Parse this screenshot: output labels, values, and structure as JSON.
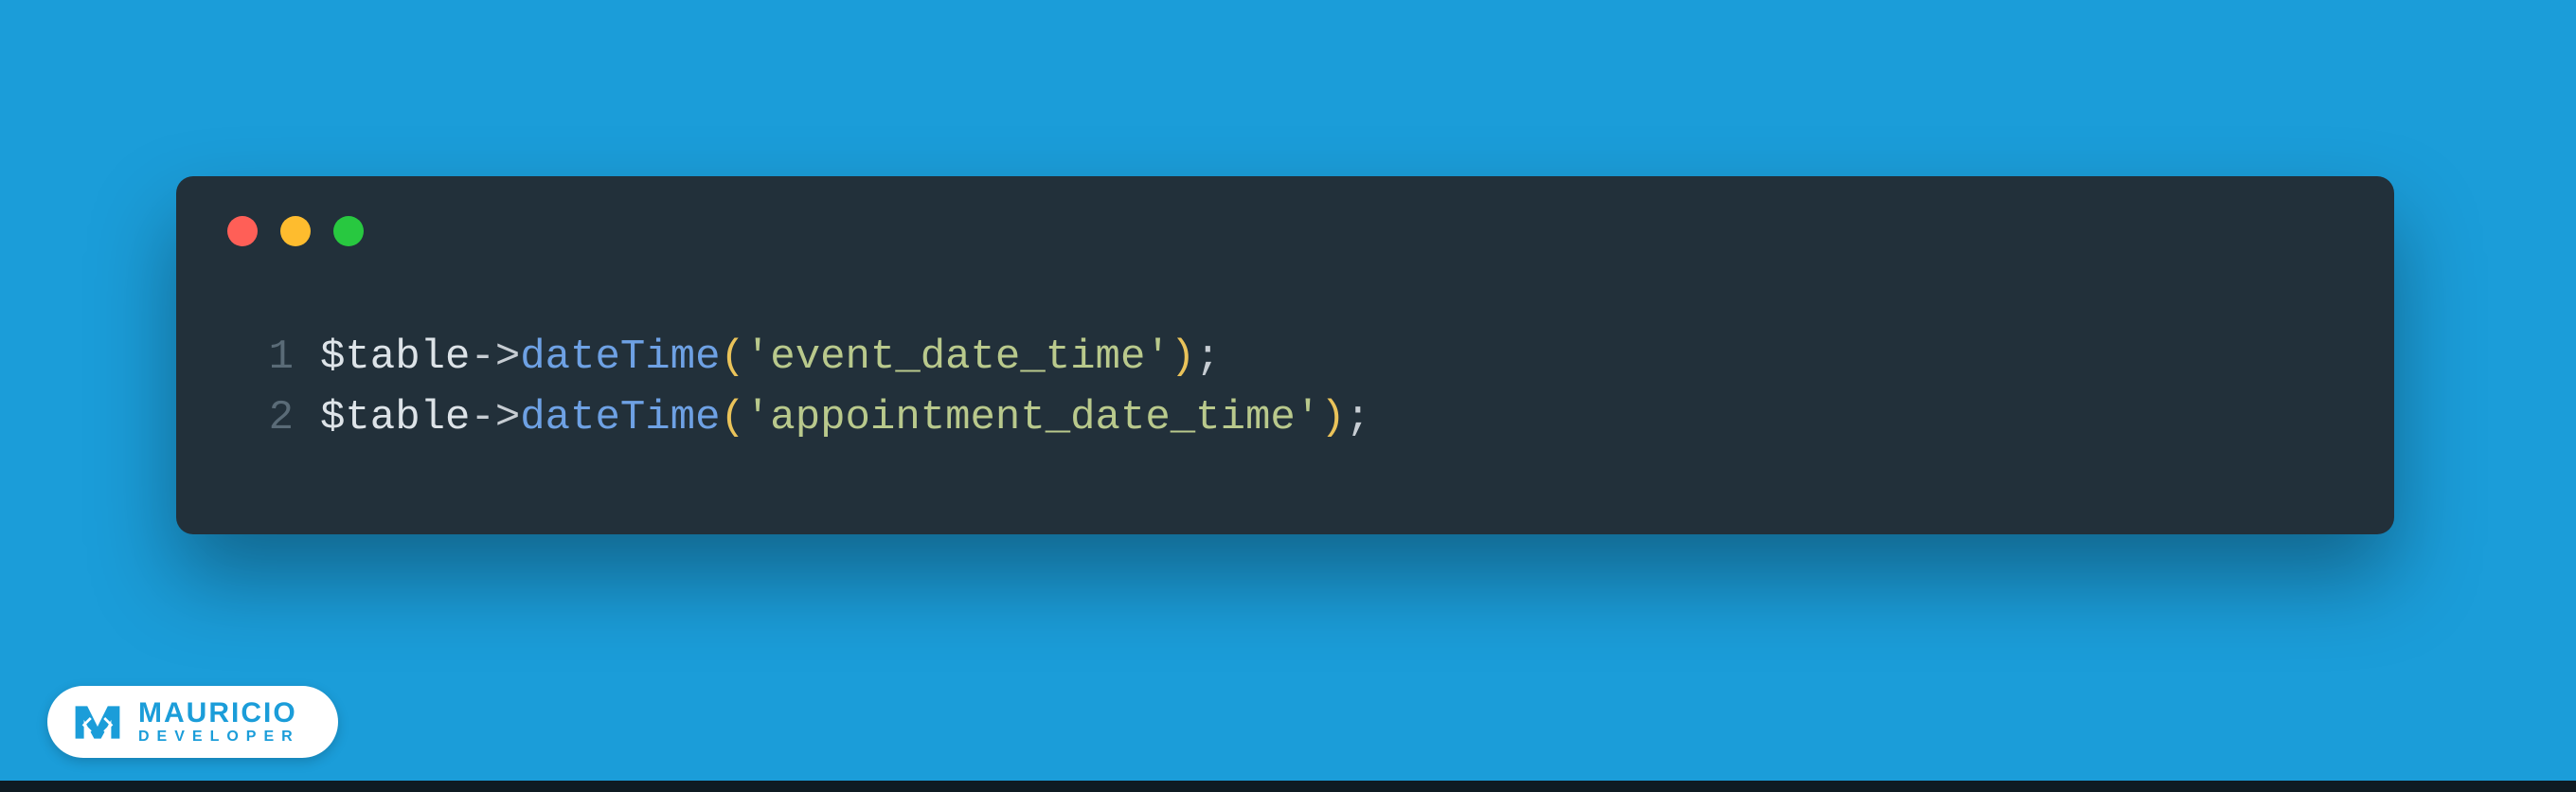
{
  "window": {
    "traffic": {
      "red": "#FF5F57",
      "yellow": "#FEBC2E",
      "green": "#28C840"
    }
  },
  "code": {
    "lines": [
      {
        "num": "1",
        "var": "$table",
        "arrow": "->",
        "method": "dateTime",
        "open": "(",
        "str": "'event_date_time'",
        "close": ")",
        "semi": ";"
      },
      {
        "num": "2",
        "var": "$table",
        "arrow": "->",
        "method": "dateTime",
        "open": "(",
        "str": "'appointment_date_time'",
        "close": ")",
        "semi": ";"
      }
    ]
  },
  "logo": {
    "main": "MAURICIO",
    "sub": "DEVELOPER"
  }
}
